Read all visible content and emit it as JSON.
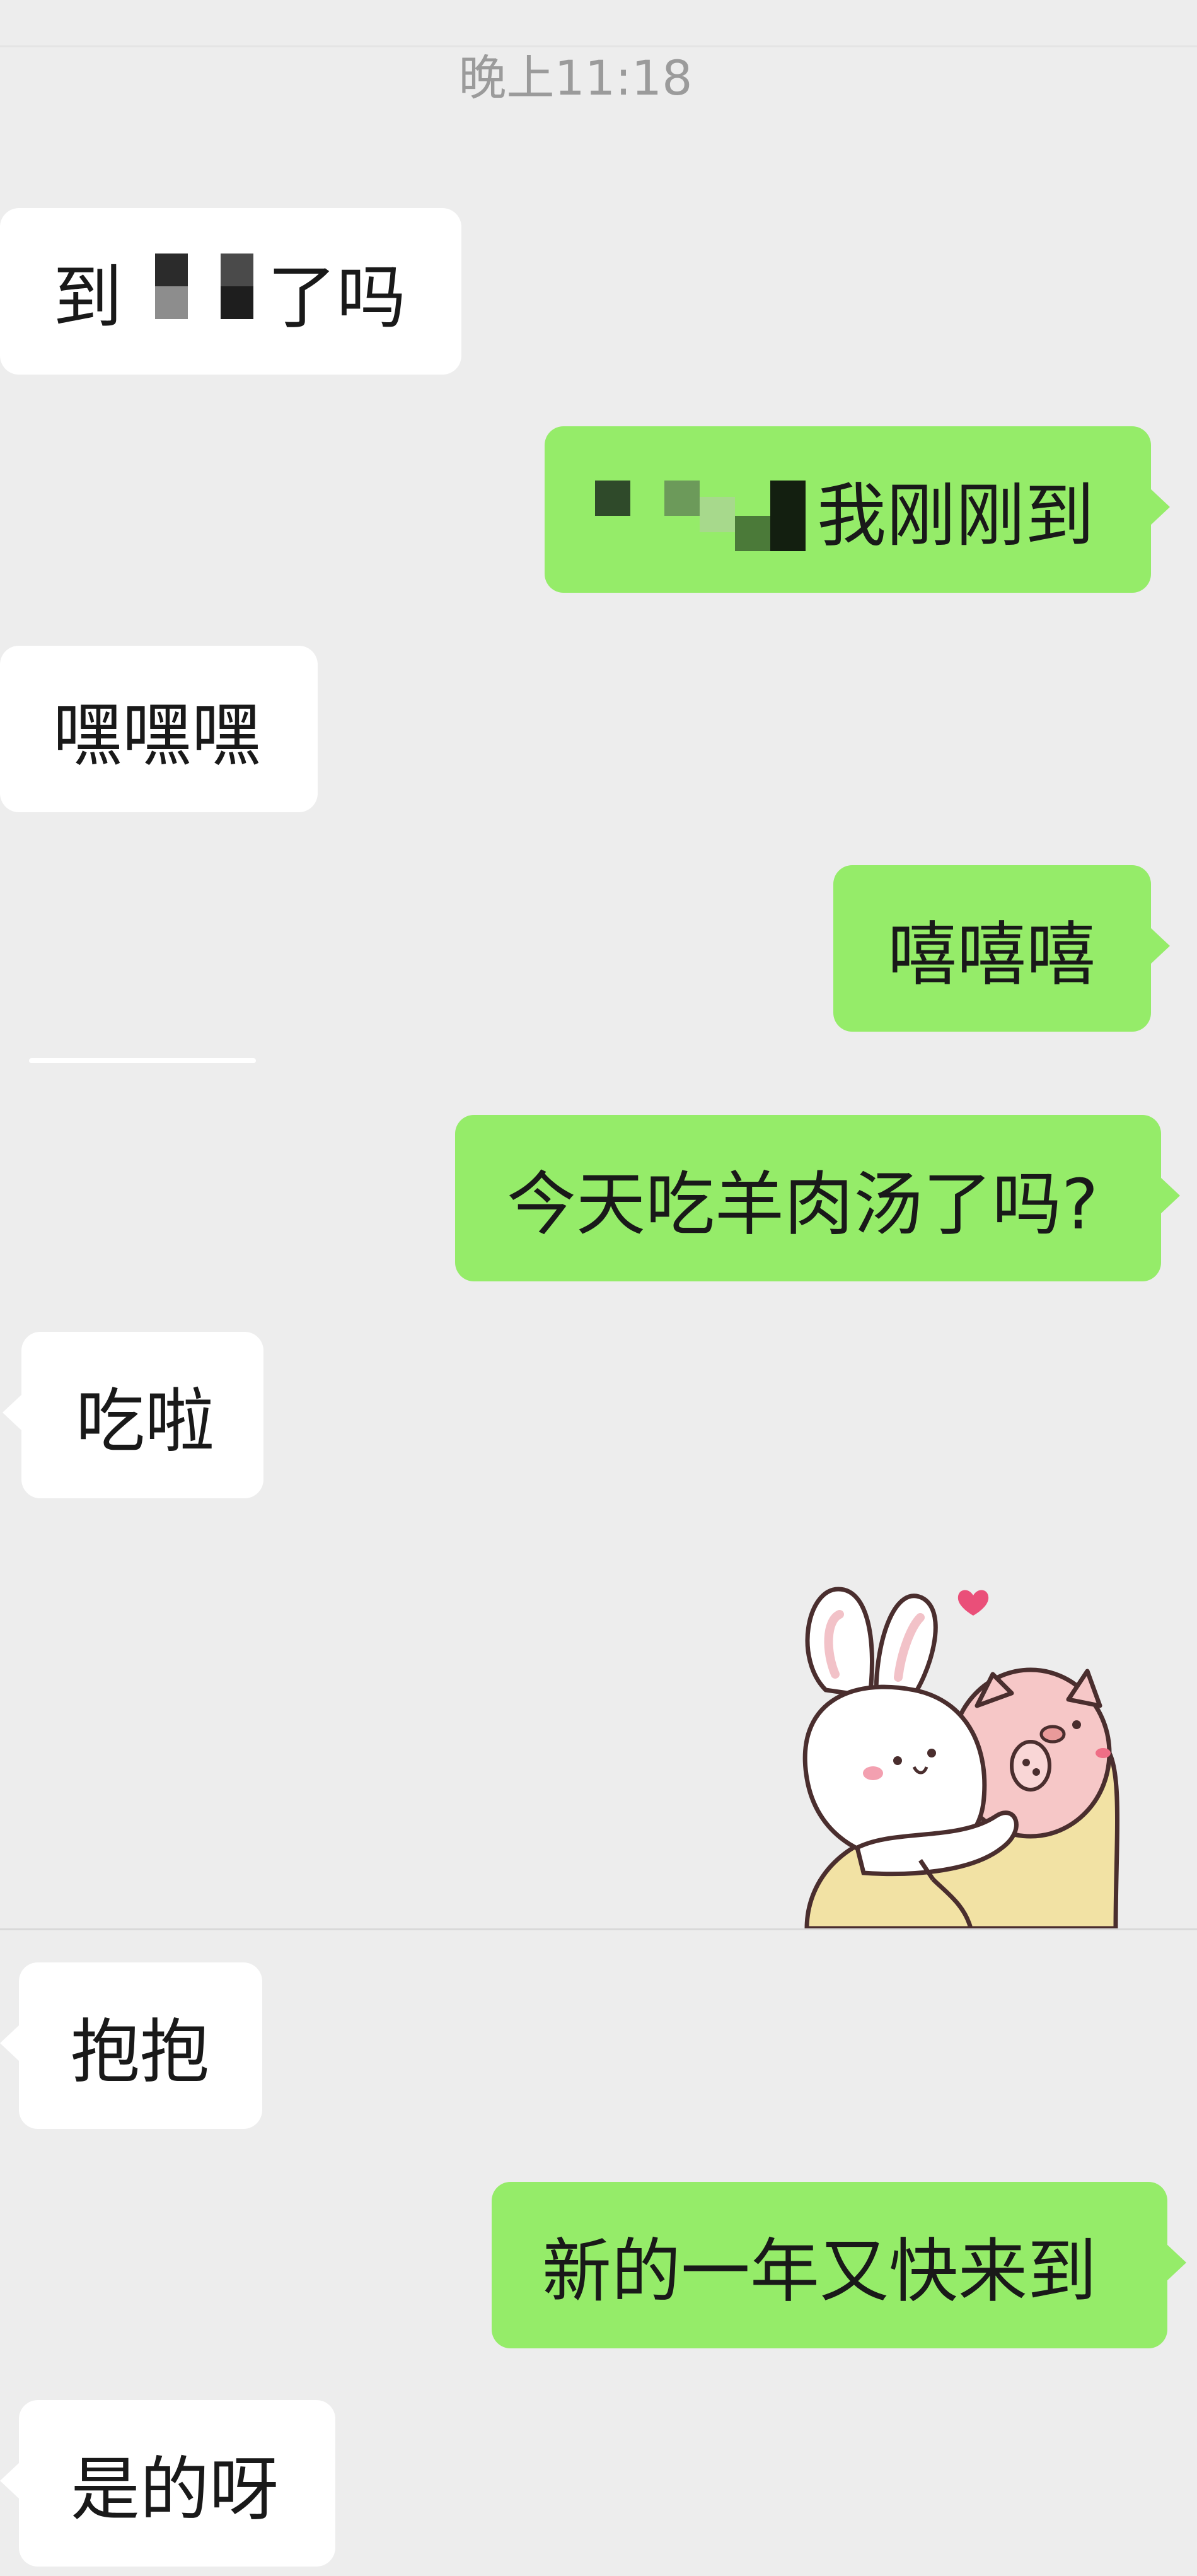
{
  "chat": {
    "timestamp": "晚上11:18",
    "messages": [
      {
        "side": "in",
        "text_before": "到",
        "text_after": "了吗",
        "redacted": true
      },
      {
        "side": "out",
        "text_after": "我刚刚到",
        "redacted": true
      },
      {
        "side": "in",
        "text": "嘿嘿嘿"
      },
      {
        "side": "out",
        "text": "嘻嘻嘻"
      },
      {
        "side": "out",
        "text": "今天吃羊肉汤了吗?"
      },
      {
        "side": "in",
        "text": "吃啦"
      },
      {
        "side": "in",
        "sticker": "bunny-hugging-pig-sticker"
      },
      {
        "side": "in",
        "text": "抱抱"
      },
      {
        "side": "out",
        "text": "新的一年又快来到"
      },
      {
        "side": "in",
        "text": "是的呀"
      }
    ]
  },
  "colors": {
    "background": "#ededed",
    "incoming_bubble": "#ffffff",
    "outgoing_bubble": "#95ec69",
    "text": "#191919",
    "timestamp": "#9b9b9b"
  }
}
